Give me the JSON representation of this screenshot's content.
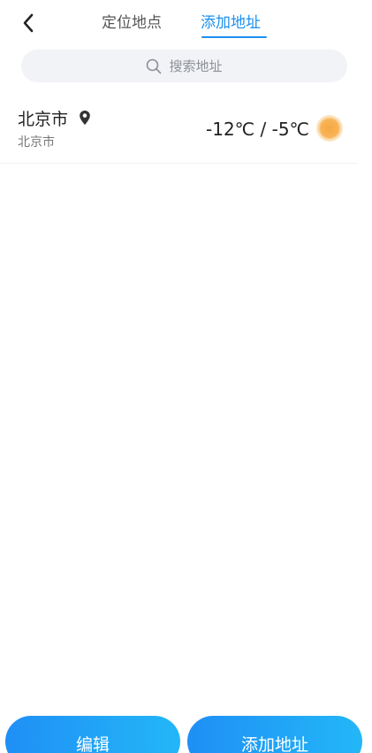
{
  "header": {
    "tabs": [
      {
        "label": "定位地点",
        "active": false
      },
      {
        "label": "添加地址",
        "active": true
      }
    ],
    "active_color": "#1a90f0"
  },
  "search": {
    "placeholder": "搜索地址"
  },
  "cities": [
    {
      "name": "北京市",
      "subtitle": "北京市",
      "temperature": "-12℃ / -5℃",
      "weather_icon": "sun-icon",
      "is_current_location": true
    }
  ],
  "buttons": {
    "edit_label": "编辑",
    "add_label": "添加地址"
  }
}
